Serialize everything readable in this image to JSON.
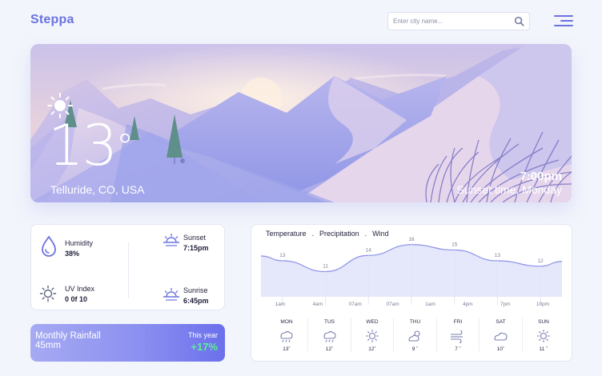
{
  "header": {
    "logo": "Steppa",
    "search_placeholder": "Enter city name..."
  },
  "hero": {
    "temperature": "13",
    "degree_symbol": "°",
    "location": "Telluride, CO, USA",
    "sunset_time": "7:00pm",
    "sunset_label": "Sunset time, Monday"
  },
  "stats": {
    "humidity_label": "Humidity",
    "humidity_value": "38%",
    "uv_label": "UV Index",
    "uv_value": "0 0f 10",
    "sunset_label": "Sunset",
    "sunset_value": "7:15pm",
    "sunrise_label": "Sunrise",
    "sunrise_value": "6:45pm"
  },
  "rainfall": {
    "title": "Monthly Rainfall",
    "amount": "45mm",
    "period": "This year",
    "change": "+17%"
  },
  "forecast": {
    "tabs": [
      "Temperature",
      "Precipitation",
      "Wind"
    ],
    "tab_separator": ".",
    "days": [
      {
        "name": "MON",
        "temp": "13˚",
        "icon": "rain-icon"
      },
      {
        "name": "TUS",
        "temp": "12˚",
        "icon": "rain-icon"
      },
      {
        "name": "WED",
        "temp": "12˚",
        "icon": "sun-icon"
      },
      {
        "name": "THU",
        "temp": "9 ˚",
        "icon": "partly-cloudy-icon"
      },
      {
        "name": "FRI",
        "temp": "7 ˚",
        "icon": "wind-icon"
      },
      {
        "name": "SAT",
        "temp": "10˚",
        "icon": "cloud-icon"
      },
      {
        "name": "SUN",
        "temp": "11 ˚",
        "icon": "sun-icon"
      }
    ]
  },
  "chart_data": {
    "type": "area",
    "title": "",
    "xlabel": "",
    "ylabel": "",
    "categories": [
      "1am",
      "4am",
      "07am",
      "07am",
      "1am",
      "4pm",
      "7pm",
      "10pm"
    ],
    "point_values": [
      13,
      11,
      14,
      16,
      15,
      13,
      12
    ],
    "accent_color": "#8a90e6",
    "fill_color": "#e5e7fb"
  },
  "colors": {
    "accent": "#6b73e0",
    "positive": "#5df08f",
    "hero_sky_top": "#c9c2ea",
    "hero_sky_bottom": "#9ea4ee"
  }
}
